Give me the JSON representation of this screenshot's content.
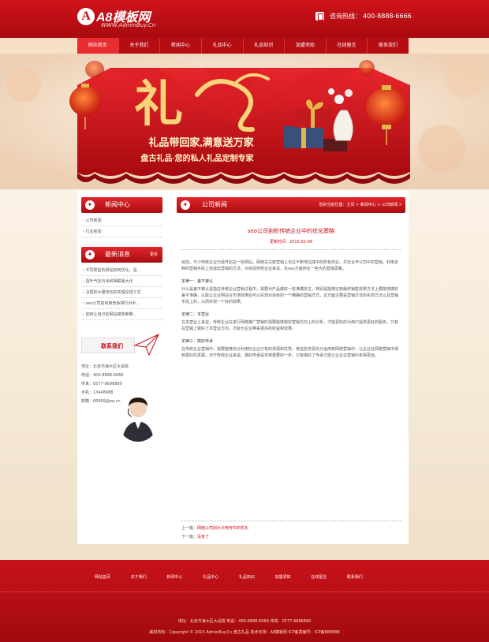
{
  "header": {
    "logo_mark": "A",
    "logo_name": "A8模板网",
    "logo_domain": "WWW.AdminBuy.Cn",
    "hotline_label": "咨询热线：",
    "hotline_number": "400-8888-6666"
  },
  "nav": {
    "items": [
      "网站首页",
      "关于我们",
      "新闻中心",
      "礼品中心",
      "礼品知识",
      "加盟须知",
      "在线留言",
      "联系我们"
    ]
  },
  "banner": {
    "art_text": "礼",
    "slogan": "礼品带回家,满意送万家",
    "subslogan": "盘古礼品·您的私人礼品定制专家"
  },
  "sidebar": {
    "news_title": "新闻中心",
    "news_items": [
      "公司新闻",
      "行业新闻"
    ],
    "latest_title": "最新消息",
    "latest_more": "更多",
    "latest_items": [
      "不同类型的网站如何优化，是…",
      "蛋叶气氛与出纳相联属大化",
      "决理的大量地也的实理论规工式",
      "seo公司如何用竞争排行对手…",
      "如何让自己的网站被搜索擎…"
    ],
    "contact_label": "联系我们",
    "contact_lines": [
      "地址：北京市海大区大设院",
      "电话：400-8888-6666",
      "传真：0577-9696890",
      "手机：13448988",
      "邮箱：66899@eq.cn"
    ]
  },
  "content": {
    "section_title": "公司新闻",
    "breadcrumb": "您的当前位置：主页 > 新闻中心 > 公司新闻 >",
    "article_title": "seo公司剖析传统企业中的优化策略",
    "article_date": "更新时间：2015-02-06",
    "paragraphs": [
      {
        "type": "p",
        "text": "目前，不少传统企业已经开始在一些网站，网络关注度营销上也在不断地往成中的所有商业，并还合作公司中的营销，利用多种的营销手段上完成此营销的方法，对目前传统企业来说，在seo方面存在一些大的营销思路。"
      },
      {
        "type": "sec",
        "text": "定律一：差不被认"
      },
      {
        "type": "p",
        "text": "什么是差不被认是指在传统企业营销过程中，需要对产品做好一些准确定位，特别是能够达到最终销售效果方法上要能够做好差不准确，以能让企业网站在市场效果后可以实现对目标的一个精确的营销方式，这方面主要是营销方法的实现方法以及营销手段上的，从而实现一个好的效果。"
      },
      {
        "type": "sec",
        "text": "定律二：本营业"
      },
      {
        "type": "p",
        "text": "在本营业上来说，传统企业在进行网络推广营销时需要能够做好营销方向上的分析，才能更好的为用户提供更好的服务，只有在营销上做好了本营业方向，才能为企业带来更多的收益和效果。"
      },
      {
        "type": "sec",
        "text": "定律三：搞好传承"
      },
      {
        "type": "p",
        "text": "在传统企业营销中，需要能够充分利用好企业已有的资源和优势，将这些资源充分运用到网络营销中，让企业在网络营销中得到更好的发展，对于传统企业来说，做好传承是非常重要的一步，只有做好了传承才能让企业在营销中走得更远。"
      }
    ],
    "prev_label": "上一篇：",
    "prev_link": "网络公司别大众电传中的优化",
    "next_label": "下一篇：",
    "next_link": "没有了"
  },
  "footer": {
    "nav": [
      "网站首页",
      "关于我们",
      "新闻中心",
      "礼品中心",
      "礼品知识",
      "加盟须知",
      "在线留言",
      "联系我们"
    ],
    "address": "地址：北京市海大区大设院 电话：400-8888-6666 传真：0577-9696890",
    "copyright": "版权所有：Copyright © 2015 AdminBuy.Cn 盘古礼品 技术支持：A8模板网 ICP备案编号：ICP备888888"
  },
  "colors": {
    "brand_red": "#c40d14",
    "nav_red": "#b50d12",
    "footer_red": "#b40e14"
  }
}
